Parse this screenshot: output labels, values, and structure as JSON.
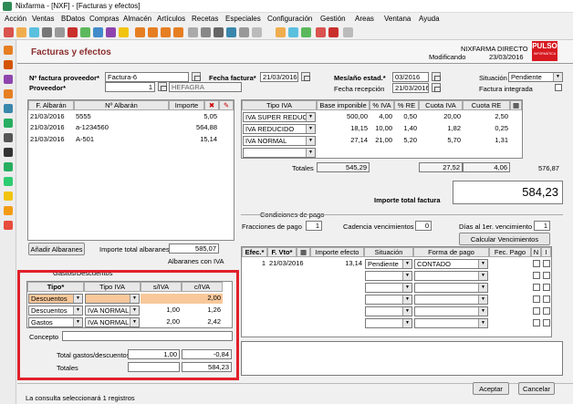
{
  "window": {
    "title": "Nixfarma - [NXF] - [Facturas y efectos]"
  },
  "menu": [
    "Acción",
    "Ventas",
    "BDatos",
    "Compras",
    "Almacén",
    "Artículos",
    "Recetas",
    "Especiales",
    "Configuración",
    "Gestión",
    "Areas",
    "Ventana",
    "Ayuda"
  ],
  "header": {
    "title": "Facturas y efectos",
    "app": "NIXFARMA DIRECTO",
    "state": "Modificando",
    "date": "23/03/2016",
    "brand": "PULSO",
    "brand_sub": "INFORMÁTICA"
  },
  "form": {
    "nfactura_label": "Nº factura proveedor*",
    "nfactura": "Factura-6",
    "fecha_label": "Fecha factura*",
    "fecha": "21/03/2016",
    "mes_label": "Mes/año estad.*",
    "mes": "03/2016",
    "situacion_label": "Situación",
    "situacion": "Pendiente",
    "proveedor_label": "Proveedor*",
    "proveedor_code": "1",
    "proveedor_name": "HEFAGRA",
    "fecharec_label": "Fecha recepción",
    "fecharec": "21/03/2016",
    "integrada_label": "Factura integrada"
  },
  "albaranes": {
    "headers": [
      "F. Albarán",
      "Nº Albarán",
      "Importe"
    ],
    "rows": [
      [
        "21/03/2016",
        "5555",
        "5,05"
      ],
      [
        "21/03/2016",
        "a-1234560",
        "564,88"
      ],
      [
        "21/03/2016",
        "A-501",
        "15,14"
      ]
    ],
    "add_button": "Añadir Albaranes",
    "total_label": "Importe total albaranes",
    "total": "585,07",
    "note": "Albaranes con IVA"
  },
  "iva": {
    "headers": [
      "Tipo IVA",
      "Base imponible",
      "% IVA",
      "% RE",
      "Cuota IVA",
      "Cuota RE"
    ],
    "rows": [
      [
        "IVA SUPER REDUCI",
        "500,00",
        "4,00",
        "0,50",
        "20,00",
        "2,50"
      ],
      [
        "IVA REDUCIDO",
        "18,15",
        "10,00",
        "1,40",
        "1,82",
        "0,25"
      ],
      [
        "IVA NORMAL",
        "27,14",
        "21,00",
        "5,20",
        "5,70",
        "1,31"
      ]
    ],
    "totals_label": "Totales",
    "tot_base": "545,29",
    "tot_iva": "27,52",
    "tot_re": "4,06",
    "tot_all": "576,87",
    "total_factura_label": "Importe total factura",
    "total_factura": "584,23"
  },
  "condiciones": {
    "title": "Condiciones de pago",
    "fracciones_label": "Fracciones de pago",
    "fracciones": "1",
    "cadencia_label": "Cadencia vencimientos",
    "cadencia": "0",
    "dias_label": "Días al 1er. vencimiento",
    "dias": "1",
    "calc_button": "Calcular Vencimientos"
  },
  "efectos": {
    "headers": [
      "Efec.*",
      "F. Vto*",
      "Importe efecto",
      "Situación",
      "Forma de pago",
      "Fec. Pago",
      "N",
      "I"
    ],
    "rows": [
      [
        "1",
        "21/03/2016",
        "13,14",
        "Pendiente",
        "CONTADO",
        ""
      ]
    ]
  },
  "gastos": {
    "title": "Gastos/Descuentos",
    "headers": [
      "Tipo*",
      "Tipo IVA",
      "s/IVA",
      "c/IVA"
    ],
    "rows": [
      [
        "Descuentos",
        "",
        "",
        "2,00"
      ],
      [
        "Descuentos",
        "IVA NORMAL",
        "1,00",
        "1,26"
      ],
      [
        "Gastos",
        "IVA NORMAL",
        "2,00",
        "2,42"
      ]
    ],
    "concepto_label": "Concepto",
    "total_label": "Total gastos/descuentos",
    "total_s": "1,00",
    "total_c": "-0,84",
    "totales_label": "Totales",
    "totales": "584,23"
  },
  "buttons": {
    "accept": "Aceptar",
    "cancel": "Cancelar"
  },
  "status": "La consulta seleccionará 1 registros"
}
